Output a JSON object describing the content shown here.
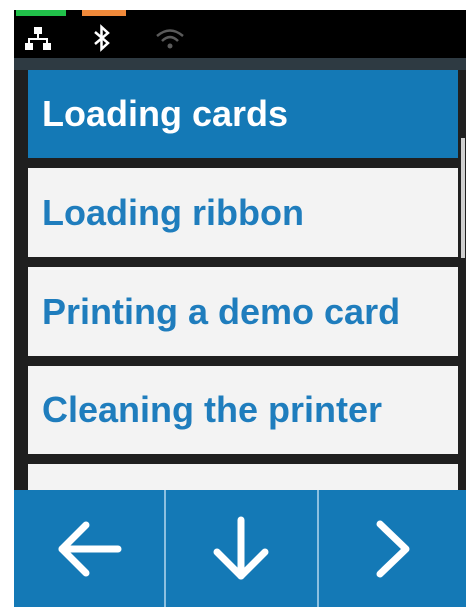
{
  "status_bar": {
    "indicators": [
      {
        "name": "green-status-indicator",
        "color": "#21c14a"
      },
      {
        "name": "orange-status-indicator",
        "color": "#f0893a"
      }
    ],
    "icons": [
      "network-icon",
      "bluetooth-icon",
      "wifi-icon"
    ]
  },
  "menu": {
    "items": [
      {
        "label": "Loading cards",
        "selected": true
      },
      {
        "label": "Loading ribbon",
        "selected": false
      },
      {
        "label": "Printing a demo card",
        "selected": false
      },
      {
        "label": "Cleaning the printer",
        "selected": false
      },
      {
        "label": "",
        "selected": false
      }
    ]
  },
  "nav": {
    "buttons": [
      {
        "name": "back-button",
        "icon": "arrow-left-icon"
      },
      {
        "name": "scroll-down-button",
        "icon": "arrow-down-icon"
      },
      {
        "name": "next-button",
        "icon": "chevron-right-icon"
      }
    ]
  },
  "colors": {
    "accent": "#1479b6",
    "item_text": "#1f7dbd",
    "item_background": "#f3f3f3",
    "status_background": "#000000"
  }
}
